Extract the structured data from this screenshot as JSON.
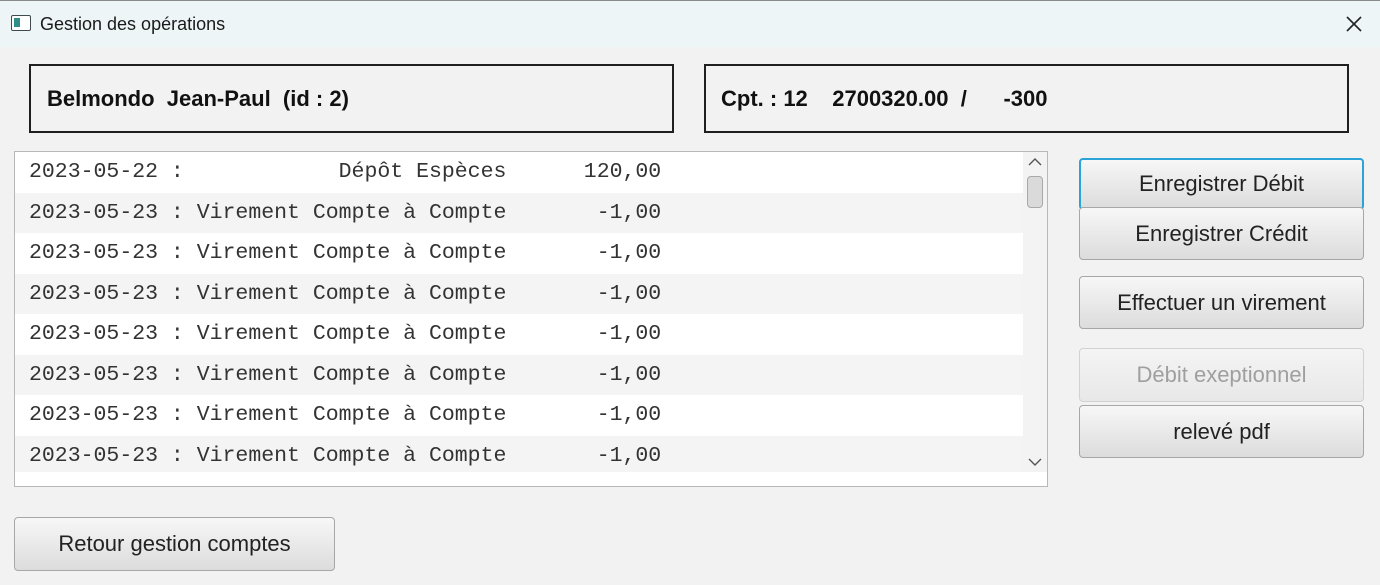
{
  "window": {
    "title": "Gestion des opérations",
    "icon": "app-window-icon",
    "close_icon": "close-icon"
  },
  "client_info": "Belmondo  Jean-Paul  (id : 2)",
  "account_info": "Cpt. : 12    2700320.00  /      -300",
  "operations": [
    {
      "date": "2023-05-22",
      "label": "Dépôt Espèces",
      "amount": "120,00"
    },
    {
      "date": "2023-05-23",
      "label": "Virement Compte à Compte",
      "amount": "-1,00"
    },
    {
      "date": "2023-05-23",
      "label": "Virement Compte à Compte",
      "amount": "-1,00"
    },
    {
      "date": "2023-05-23",
      "label": "Virement Compte à Compte",
      "amount": "-1,00"
    },
    {
      "date": "2023-05-23",
      "label": "Virement Compte à Compte",
      "amount": "-1,00"
    },
    {
      "date": "2023-05-23",
      "label": "Virement Compte à Compte",
      "amount": "-1,00"
    },
    {
      "date": "2023-05-23",
      "label": "Virement Compte à Compte",
      "amount": "-1,00"
    },
    {
      "date": "2023-05-23",
      "label": "Virement Compte à Compte",
      "amount": "-1,00"
    }
  ],
  "buttons": {
    "debit": "Enregistrer Débit",
    "credit": "Enregistrer Crédit",
    "virement": "Effectuer un virement",
    "exception": "Débit exeptionnel",
    "pdf": "relevé pdf",
    "retour": "Retour gestion comptes"
  },
  "colors": {
    "focus_border": "#2aa3d6",
    "disabled_text": "#9f9f9f",
    "titlebar_bg": "#eef5f7"
  }
}
